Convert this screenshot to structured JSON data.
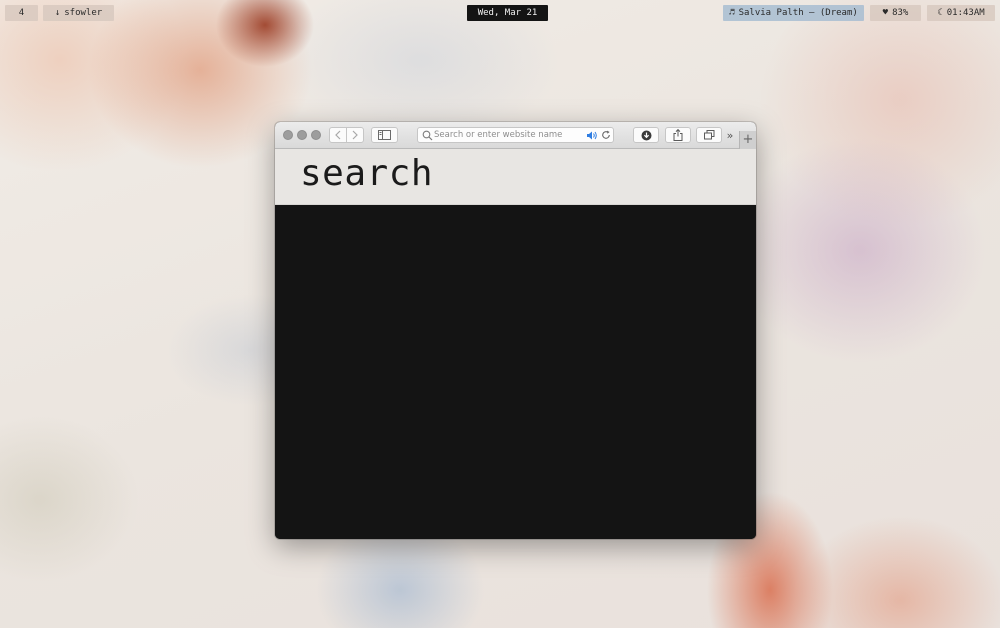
{
  "topbar": {
    "workspace": "4",
    "user": {
      "icon": "arrow-down-icon",
      "label": "sfowler"
    },
    "date": "Wed, Mar 21",
    "music": {
      "icon": "music-note-icon",
      "label": "Salvia Palth — (Dream)"
    },
    "battery": {
      "icon": "heart-icon",
      "label": "83%"
    },
    "clock": {
      "icon": "moon-icon",
      "label": "01:43AM"
    }
  },
  "browser": {
    "address_placeholder": "Search or enter website name",
    "page_title": "search",
    "colors": {
      "audio_icon": "#2f7de1",
      "content_bg": "#141414",
      "header_bg": "#e8e6e3"
    }
  }
}
